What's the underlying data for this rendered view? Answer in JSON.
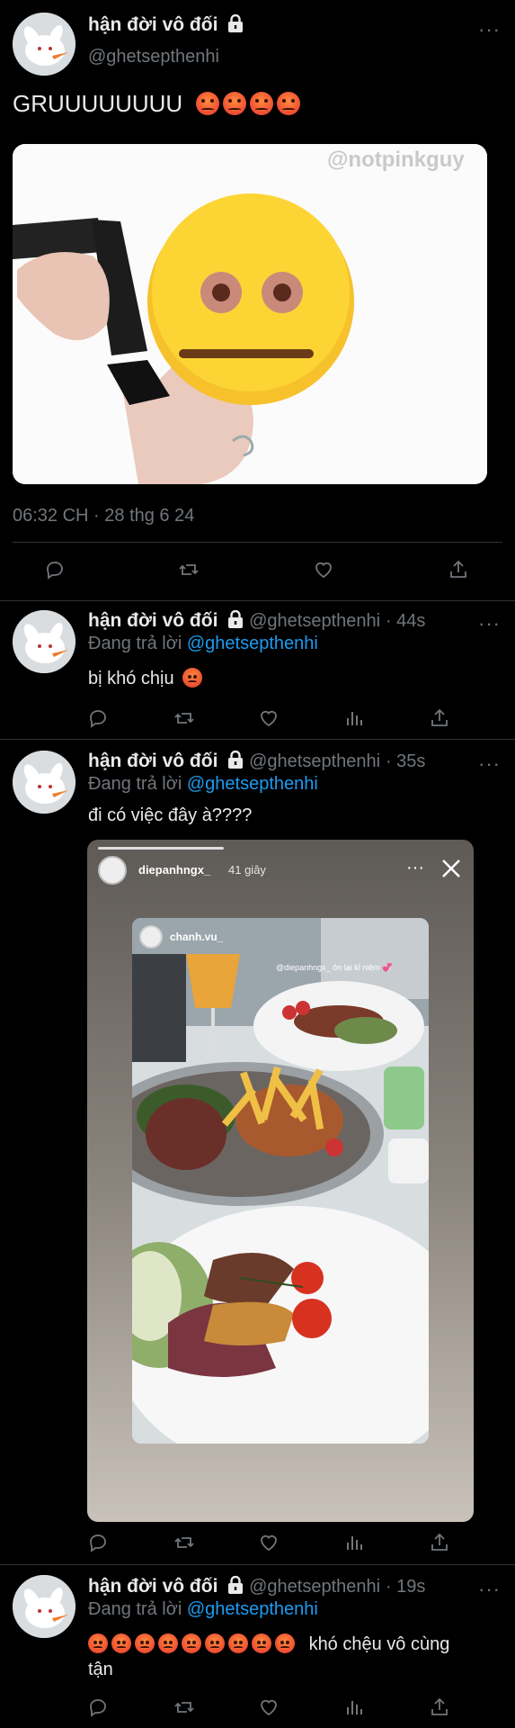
{
  "tweet": {
    "display_name": "hận đời vô đối",
    "handle": "@ghetsepthenhi",
    "text": "GRUUUUUUUU",
    "media_watermark": "@notpinkguy",
    "timestamp": "06:32 CH · 28 thg 6 24",
    "angry_emoji_count": 4
  },
  "replies": [
    {
      "display_name": "hận đời vô đối",
      "handle": "@ghetsepthenhi",
      "time": "· 44s",
      "replying_label": "Đang trả lời",
      "replying_to": "@ghetsepthenhi",
      "text": "bị khó chịu"
    },
    {
      "display_name": "hận đời vô đối",
      "handle": "@ghetsepthenhi",
      "time": "· 35s",
      "replying_label": "Đang trả lời",
      "replying_to": "@ghetsepthenhi",
      "text": "đi có việc đây à????",
      "story": {
        "user": "diepanhngx_",
        "age": "41 giây",
        "inner_user": "chanh.vu_",
        "inner_caption": "@diepanhngx_ ôn lại kỉ niệm 💞"
      }
    },
    {
      "display_name": "hận đời vô đối",
      "handle": "@ghetsepthenhi",
      "time": "· 19s",
      "replying_label": "Đang trả lời",
      "replying_to": "@ghetsepthenhi",
      "text_line1": "khó chệu vô cùng",
      "text_line2": "tận",
      "angry_emoji_count": 9
    }
  ],
  "colors": {
    "background": "#000000",
    "text": "#e7e9ea",
    "secondary": "#71767b",
    "accent": "#1d9bf0",
    "divider": "#2f3336"
  },
  "icons": [
    "more-icon",
    "lock-icon",
    "reply-icon",
    "retweet-icon",
    "like-icon",
    "views-icon",
    "share-icon",
    "close-icon"
  ]
}
